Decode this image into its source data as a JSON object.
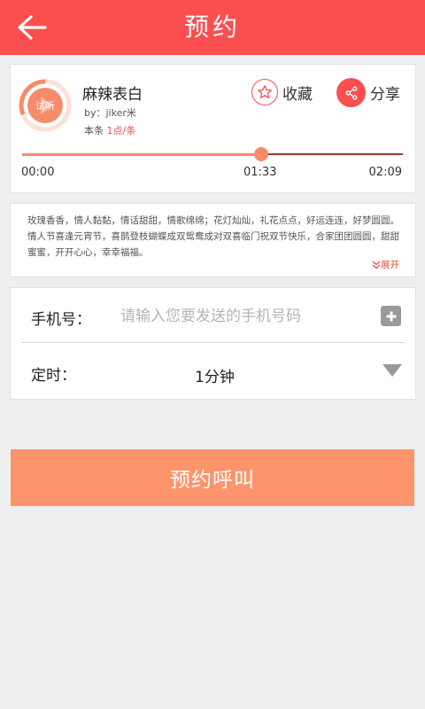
{
  "header": {
    "title": "预约"
  },
  "player": {
    "song_title": "麻辣表白",
    "by": "by：jiker米",
    "price_prefix": "本条",
    "price_value": "1点/条",
    "disc_text": "试听",
    "favorite_label": "收藏",
    "share_label": "分享",
    "time_start": "00:00",
    "time_current": "01:33",
    "time_end": "02:09",
    "progress": 0.628,
    "colors": {
      "accent": "#fb4f4f",
      "progress": "#f68b6a",
      "track": "#9b3b2e"
    }
  },
  "description": {
    "text": "玫瑰香香，情人黏黏，情话甜甜，情歌绵绵；花灯灿灿，礼花点点，好运连连，好梦圆圆。情人节喜逢元宵节，喜鹊登枝蝴蝶成双鸳鸯成对双喜临门祝双节快乐，合家团团圆圆，甜甜蜜蜜，开开心心，幸幸福福。",
    "expand_label": "展开"
  },
  "form": {
    "phone_label": "手机号：",
    "phone_placeholder": "请输入您要发送的手机号码",
    "phone_value": "",
    "timer_label": "定时：",
    "timer_value": "1分钟"
  },
  "actions": {
    "call_label": "预约呼叫",
    "call_color": "#fe946b"
  }
}
